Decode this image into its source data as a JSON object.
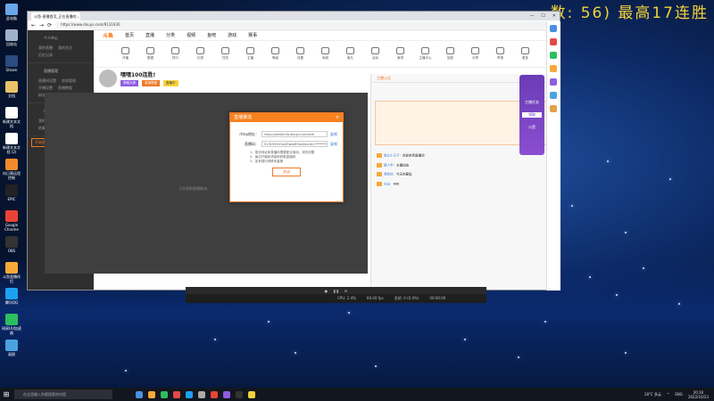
{
  "desktop": {
    "overlay_banner": "数: 56) 最高17连胜",
    "icons": [
      {
        "label": "此电脑",
        "color": "#6aa6e8"
      },
      {
        "label": "回收站",
        "color": "#9fb3c8"
      },
      {
        "label": "Steam",
        "color": "#2b4c7e"
      },
      {
        "label": "文档",
        "color": "#e8c36a"
      },
      {
        "label": "新建文本文档",
        "color": "#ffffff"
      },
      {
        "label": "新建文本文档 (2)",
        "color": "#ffffff"
      },
      {
        "label": "向日葵远程控制",
        "color": "#f08a2a"
      },
      {
        "label": "EPIC",
        "color": "#222222"
      },
      {
        "label": "Google Chrome",
        "color": "#ea4335"
      },
      {
        "label": "OBS",
        "color": "#333333"
      },
      {
        "label": "斗鱼直播伴侣",
        "color": "#f7a93a"
      },
      {
        "label": "腾讯QQ",
        "color": "#1da1f2"
      },
      {
        "label": "网易UU加速器",
        "color": "#2dbe60"
      },
      {
        "label": "画图",
        "color": "#4aa3df"
      }
    ],
    "stars": true
  },
  "browser": {
    "tab_title": "斗鱼-直播首页_正在直播的...",
    "address": "https://www.douyu.com/9131930",
    "window_controls": [
      "—",
      "☐",
      "✕"
    ]
  },
  "site": {
    "logo": "斗鱼",
    "nav": [
      "首页",
      "直播",
      "分类",
      "视频",
      "鱼吧",
      "游戏",
      "赛事"
    ],
    "tools": [
      "开播",
      "数据",
      "排行",
      "礼物",
      "任务",
      "主播",
      "等级",
      "设置",
      "商城",
      "鱼丸",
      "活动",
      "鱼吧",
      "主播中心",
      "回放",
      "分享",
      "举报",
      "更多"
    ],
    "room_title": "嘿嘿100连胜!",
    "room_tags": [
      "荣耀大神",
      "英雄联盟"
    ],
    "room_badge": "直播中"
  },
  "sidebar": {
    "sections": [
      {
        "title": "个人中心",
        "items": [
          "我的直播",
          "我的关注",
          "历史记录"
        ]
      },
      {
        "title": "直播管理",
        "items": [
          "直播间设置",
          "房间管理",
          "开播设置",
          "直播数据",
          "粉丝管理"
        ]
      },
      {
        "title": "收益管理",
        "items": [
          "我的收益",
          "提现",
          "结算记录"
        ]
      }
    ],
    "action_button": "开始直播"
  },
  "dialog": {
    "title": "直播推流",
    "rtmp_label": "rtmp地址：",
    "rtmp_value": "rtmp://sendtc3a.douyu.com/live",
    "code_label": "直播码：",
    "code_value": "9131930rOa4ZIwzsB?wsSecret=*******",
    "copy_label": "复制",
    "notes": [
      "1、推流地址和直播码需要配合使用，请勿泄露",
      "2、每次开播前请重新获取直播码",
      "3、如有疑问请联系客服"
    ],
    "close_label": "关闭"
  },
  "player": {
    "hint": "正在获取直播推流..."
  },
  "right_panel": {
    "header": "主播公告",
    "chat": [
      {
        "user": "鱼丸小王子",
        "text": "欢迎来到直播间"
      },
      {
        "user": "路人甲",
        "text": "主播加油"
      },
      {
        "user": "老粉丝",
        "text": "今天也要赢"
      },
      {
        "user": "水友",
        "text": "666"
      }
    ]
  },
  "widget": {
    "line1": "主播任务",
    "line2": "领取",
    "line3": "火箭"
  },
  "obs": {
    "stats": [
      "CPU: 2.4%",
      "60.00 fps",
      "丢帧: 0 (0.0%)",
      "00:00:00"
    ]
  },
  "taskbar": {
    "search_placeholder": "在这里输入你要搜索的内容",
    "weather": "18°C 多云",
    "ime": "ENG",
    "time": "20:16",
    "date": "2022/10/23"
  }
}
